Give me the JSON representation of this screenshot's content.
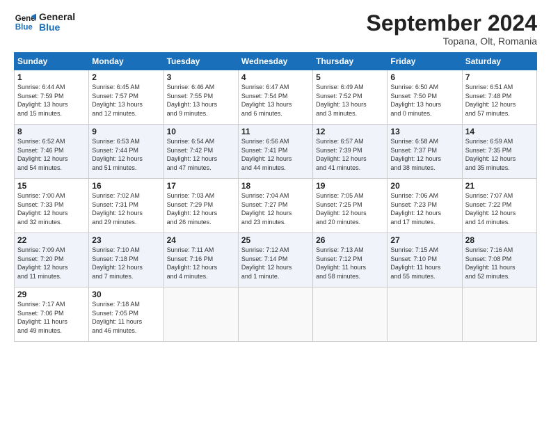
{
  "header": {
    "logo_line1": "General",
    "logo_line2": "Blue",
    "month_year": "September 2024",
    "location": "Topana, Olt, Romania"
  },
  "weekdays": [
    "Sunday",
    "Monday",
    "Tuesday",
    "Wednesday",
    "Thursday",
    "Friday",
    "Saturday"
  ],
  "weeks": [
    [
      {
        "day": "1",
        "info": "Sunrise: 6:44 AM\nSunset: 7:59 PM\nDaylight: 13 hours\nand 15 minutes."
      },
      {
        "day": "2",
        "info": "Sunrise: 6:45 AM\nSunset: 7:57 PM\nDaylight: 13 hours\nand 12 minutes."
      },
      {
        "day": "3",
        "info": "Sunrise: 6:46 AM\nSunset: 7:55 PM\nDaylight: 13 hours\nand 9 minutes."
      },
      {
        "day": "4",
        "info": "Sunrise: 6:47 AM\nSunset: 7:54 PM\nDaylight: 13 hours\nand 6 minutes."
      },
      {
        "day": "5",
        "info": "Sunrise: 6:49 AM\nSunset: 7:52 PM\nDaylight: 13 hours\nand 3 minutes."
      },
      {
        "day": "6",
        "info": "Sunrise: 6:50 AM\nSunset: 7:50 PM\nDaylight: 13 hours\nand 0 minutes."
      },
      {
        "day": "7",
        "info": "Sunrise: 6:51 AM\nSunset: 7:48 PM\nDaylight: 12 hours\nand 57 minutes."
      }
    ],
    [
      {
        "day": "8",
        "info": "Sunrise: 6:52 AM\nSunset: 7:46 PM\nDaylight: 12 hours\nand 54 minutes."
      },
      {
        "day": "9",
        "info": "Sunrise: 6:53 AM\nSunset: 7:44 PM\nDaylight: 12 hours\nand 51 minutes."
      },
      {
        "day": "10",
        "info": "Sunrise: 6:54 AM\nSunset: 7:42 PM\nDaylight: 12 hours\nand 47 minutes."
      },
      {
        "day": "11",
        "info": "Sunrise: 6:56 AM\nSunset: 7:41 PM\nDaylight: 12 hours\nand 44 minutes."
      },
      {
        "day": "12",
        "info": "Sunrise: 6:57 AM\nSunset: 7:39 PM\nDaylight: 12 hours\nand 41 minutes."
      },
      {
        "day": "13",
        "info": "Sunrise: 6:58 AM\nSunset: 7:37 PM\nDaylight: 12 hours\nand 38 minutes."
      },
      {
        "day": "14",
        "info": "Sunrise: 6:59 AM\nSunset: 7:35 PM\nDaylight: 12 hours\nand 35 minutes."
      }
    ],
    [
      {
        "day": "15",
        "info": "Sunrise: 7:00 AM\nSunset: 7:33 PM\nDaylight: 12 hours\nand 32 minutes."
      },
      {
        "day": "16",
        "info": "Sunrise: 7:02 AM\nSunset: 7:31 PM\nDaylight: 12 hours\nand 29 minutes."
      },
      {
        "day": "17",
        "info": "Sunrise: 7:03 AM\nSunset: 7:29 PM\nDaylight: 12 hours\nand 26 minutes."
      },
      {
        "day": "18",
        "info": "Sunrise: 7:04 AM\nSunset: 7:27 PM\nDaylight: 12 hours\nand 23 minutes."
      },
      {
        "day": "19",
        "info": "Sunrise: 7:05 AM\nSunset: 7:25 PM\nDaylight: 12 hours\nand 20 minutes."
      },
      {
        "day": "20",
        "info": "Sunrise: 7:06 AM\nSunset: 7:23 PM\nDaylight: 12 hours\nand 17 minutes."
      },
      {
        "day": "21",
        "info": "Sunrise: 7:07 AM\nSunset: 7:22 PM\nDaylight: 12 hours\nand 14 minutes."
      }
    ],
    [
      {
        "day": "22",
        "info": "Sunrise: 7:09 AM\nSunset: 7:20 PM\nDaylight: 12 hours\nand 11 minutes."
      },
      {
        "day": "23",
        "info": "Sunrise: 7:10 AM\nSunset: 7:18 PM\nDaylight: 12 hours\nand 7 minutes."
      },
      {
        "day": "24",
        "info": "Sunrise: 7:11 AM\nSunset: 7:16 PM\nDaylight: 12 hours\nand 4 minutes."
      },
      {
        "day": "25",
        "info": "Sunrise: 7:12 AM\nSunset: 7:14 PM\nDaylight: 12 hours\nand 1 minute."
      },
      {
        "day": "26",
        "info": "Sunrise: 7:13 AM\nSunset: 7:12 PM\nDaylight: 11 hours\nand 58 minutes."
      },
      {
        "day": "27",
        "info": "Sunrise: 7:15 AM\nSunset: 7:10 PM\nDaylight: 11 hours\nand 55 minutes."
      },
      {
        "day": "28",
        "info": "Sunrise: 7:16 AM\nSunset: 7:08 PM\nDaylight: 11 hours\nand 52 minutes."
      }
    ],
    [
      {
        "day": "29",
        "info": "Sunrise: 7:17 AM\nSunset: 7:06 PM\nDaylight: 11 hours\nand 49 minutes."
      },
      {
        "day": "30",
        "info": "Sunrise: 7:18 AM\nSunset: 7:05 PM\nDaylight: 11 hours\nand 46 minutes."
      },
      {
        "day": "",
        "info": ""
      },
      {
        "day": "",
        "info": ""
      },
      {
        "day": "",
        "info": ""
      },
      {
        "day": "",
        "info": ""
      },
      {
        "day": "",
        "info": ""
      }
    ]
  ]
}
